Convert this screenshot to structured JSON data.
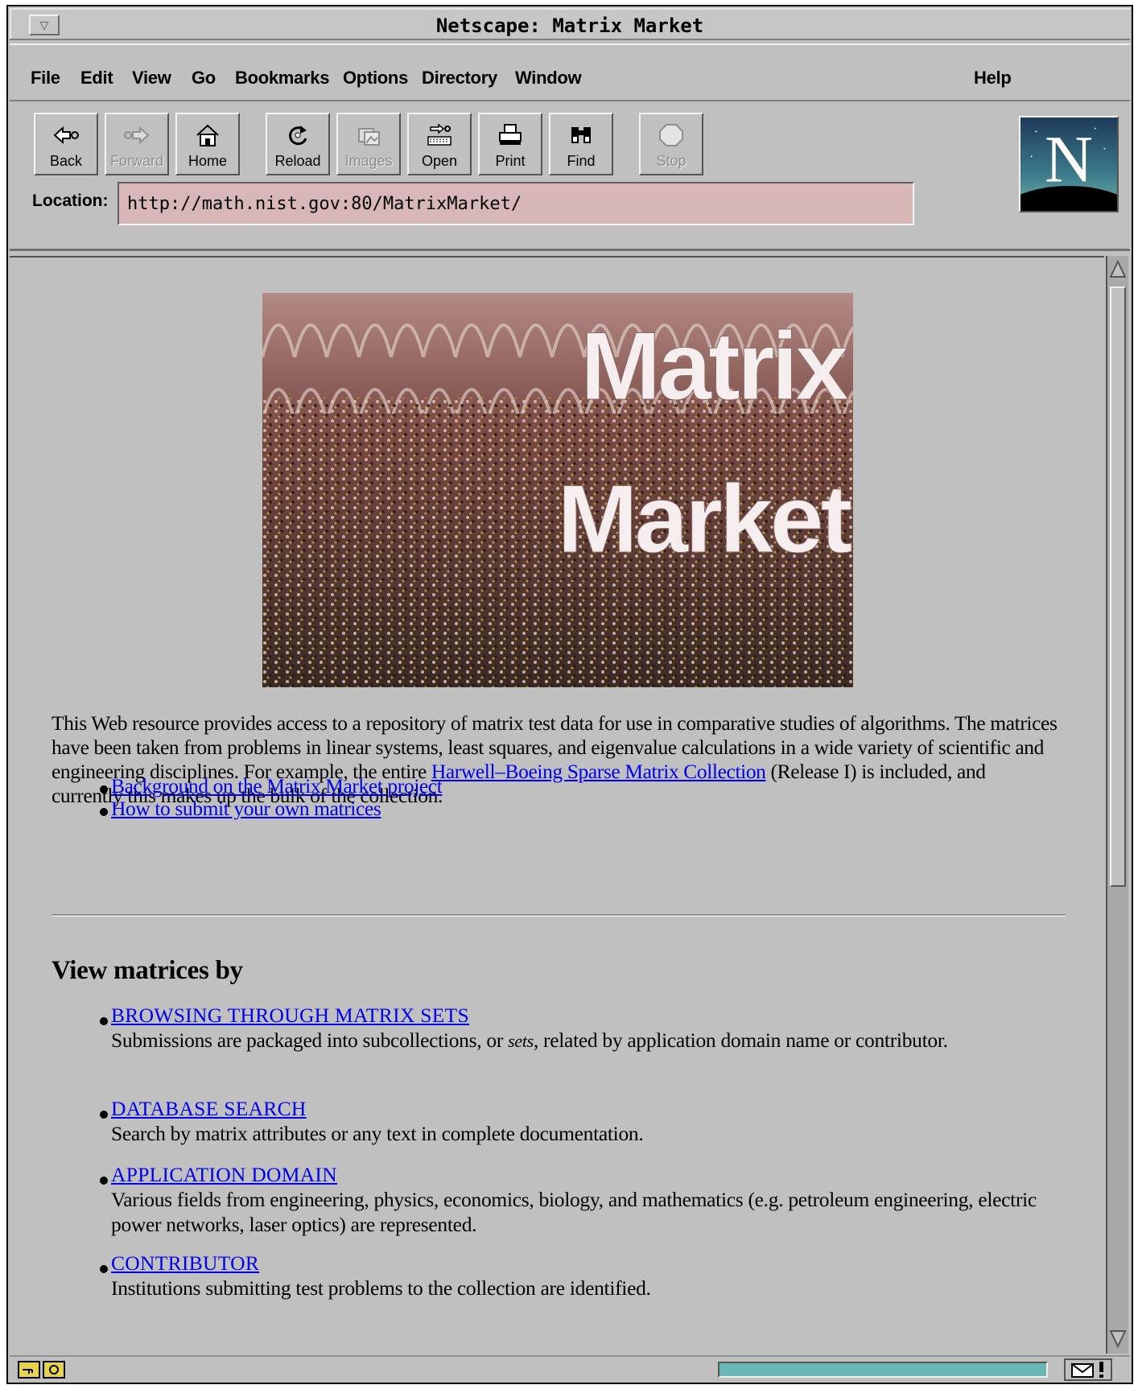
{
  "window": {
    "title": "Netscape: Matrix Market"
  },
  "menu": {
    "items": [
      "File",
      "Edit",
      "View",
      "Go",
      "Bookmarks",
      "Options",
      "Directory",
      "Window"
    ],
    "help": "Help"
  },
  "toolbar": {
    "back": "Back",
    "forward": "Forward",
    "home": "Home",
    "reload": "Reload",
    "images": "Images",
    "open": "Open",
    "print": "Print",
    "find": "Find",
    "stop": "Stop"
  },
  "location": {
    "label": "Location:",
    "url": "http://math.nist.gov:80/MatrixMarket/"
  },
  "banner": {
    "line1": "Matrix",
    "line2": "Market"
  },
  "intro": {
    "text1": "This Web resource provides access to a repository of matrix test data for use in comparative studies of algorithms. The matrices have been taken from problems in linear systems, least squares, and eigenvalue calculations in a wide variety of scientific and engineering disciplines. For example, the entire ",
    "link": "Harwell–Boeing Sparse Matrix Collection",
    "text2": " (Release I) is included, and currently this makes up the bulk of the collection."
  },
  "links": {
    "background": "Background on the Matrix Market project",
    "submit": "How to submit your own matrices"
  },
  "view": {
    "heading": "View matrices by",
    "items": [
      {
        "link": "BROWSING THROUGH MATRIX SETS",
        "desc_a": "Submissions are packaged into subcollections, or ",
        "desc_em": "sets",
        "desc_b": ", related by application domain name or contributor."
      },
      {
        "link": "DATABASE SEARCH",
        "desc": "Search by matrix attributes or any text in complete documentation."
      },
      {
        "link": "APPLICATION DOMAIN",
        "desc": "Various fields from engineering, physics, economics, biology, and mathematics (e.g. petroleum engineering, electric power networks, laser optics) are represented."
      },
      {
        "link": "CONTRIBUTOR",
        "desc": "Institutions submitting test problems to the collection are identified."
      }
    ]
  },
  "colors": {
    "link": "#0000ee",
    "chrome": "#c0c0c0",
    "location_bg": "#d7b7b7",
    "progress": "#69b7b7"
  }
}
